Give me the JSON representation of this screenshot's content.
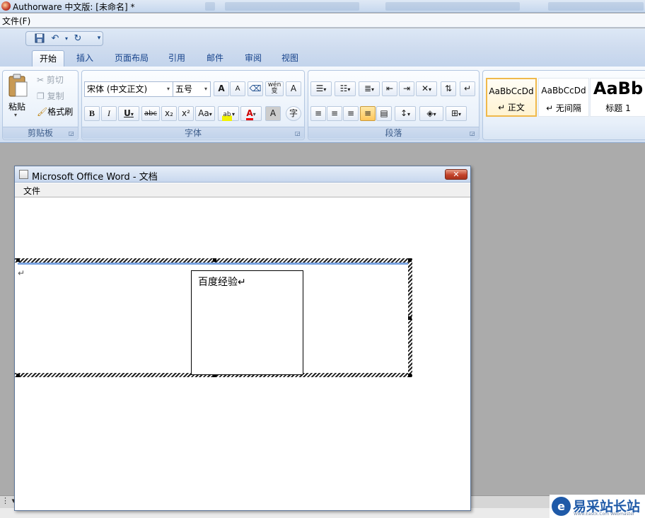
{
  "window": {
    "title": "Authorware 中文版: [未命名] *"
  },
  "menubar": {
    "file": "文件(F)"
  },
  "ribbon": {
    "tabs": [
      "开始",
      "插入",
      "页面布局",
      "引用",
      "邮件",
      "审阅",
      "视图"
    ],
    "active_tab": "开始",
    "clipboard": {
      "paste": "粘贴",
      "cut": "剪切",
      "copy": "复制",
      "format_painter": "格式刷",
      "label": "剪贴板"
    },
    "font": {
      "family": "宋体 (中文正文)",
      "size": "五号",
      "label": "字体",
      "bold": "B",
      "italic": "I",
      "underline": "U",
      "strike": "abc",
      "sub": "x₂",
      "sup": "x²",
      "case": "Aa",
      "color_letter": "A",
      "grow": "A",
      "shrink": "A",
      "wen": "wén",
      "wen_char": "变",
      "border_char": "A",
      "phonetic": "字"
    },
    "paragraph": {
      "label": "段落"
    },
    "styles": [
      {
        "sample": "AaBbCcDd",
        "name": "↵ 正文"
      },
      {
        "sample": "AaBbCcDd",
        "name": "↵ 无间隔"
      },
      {
        "sample": "AaBb",
        "name": "标题 1"
      }
    ]
  },
  "word_window": {
    "title": "Microsoft Office Word  - 文档",
    "menu_file": "文件",
    "close": "✕",
    "cell_text": "百度经验↵"
  },
  "watermark": {
    "text": "易采站长站",
    "sub": "Www.Easck.Com  Webmaster"
  },
  "colors": {
    "ribbon_text": "#15428b",
    "accent": "#1f5aa8",
    "highlight": "#ffc65a"
  }
}
